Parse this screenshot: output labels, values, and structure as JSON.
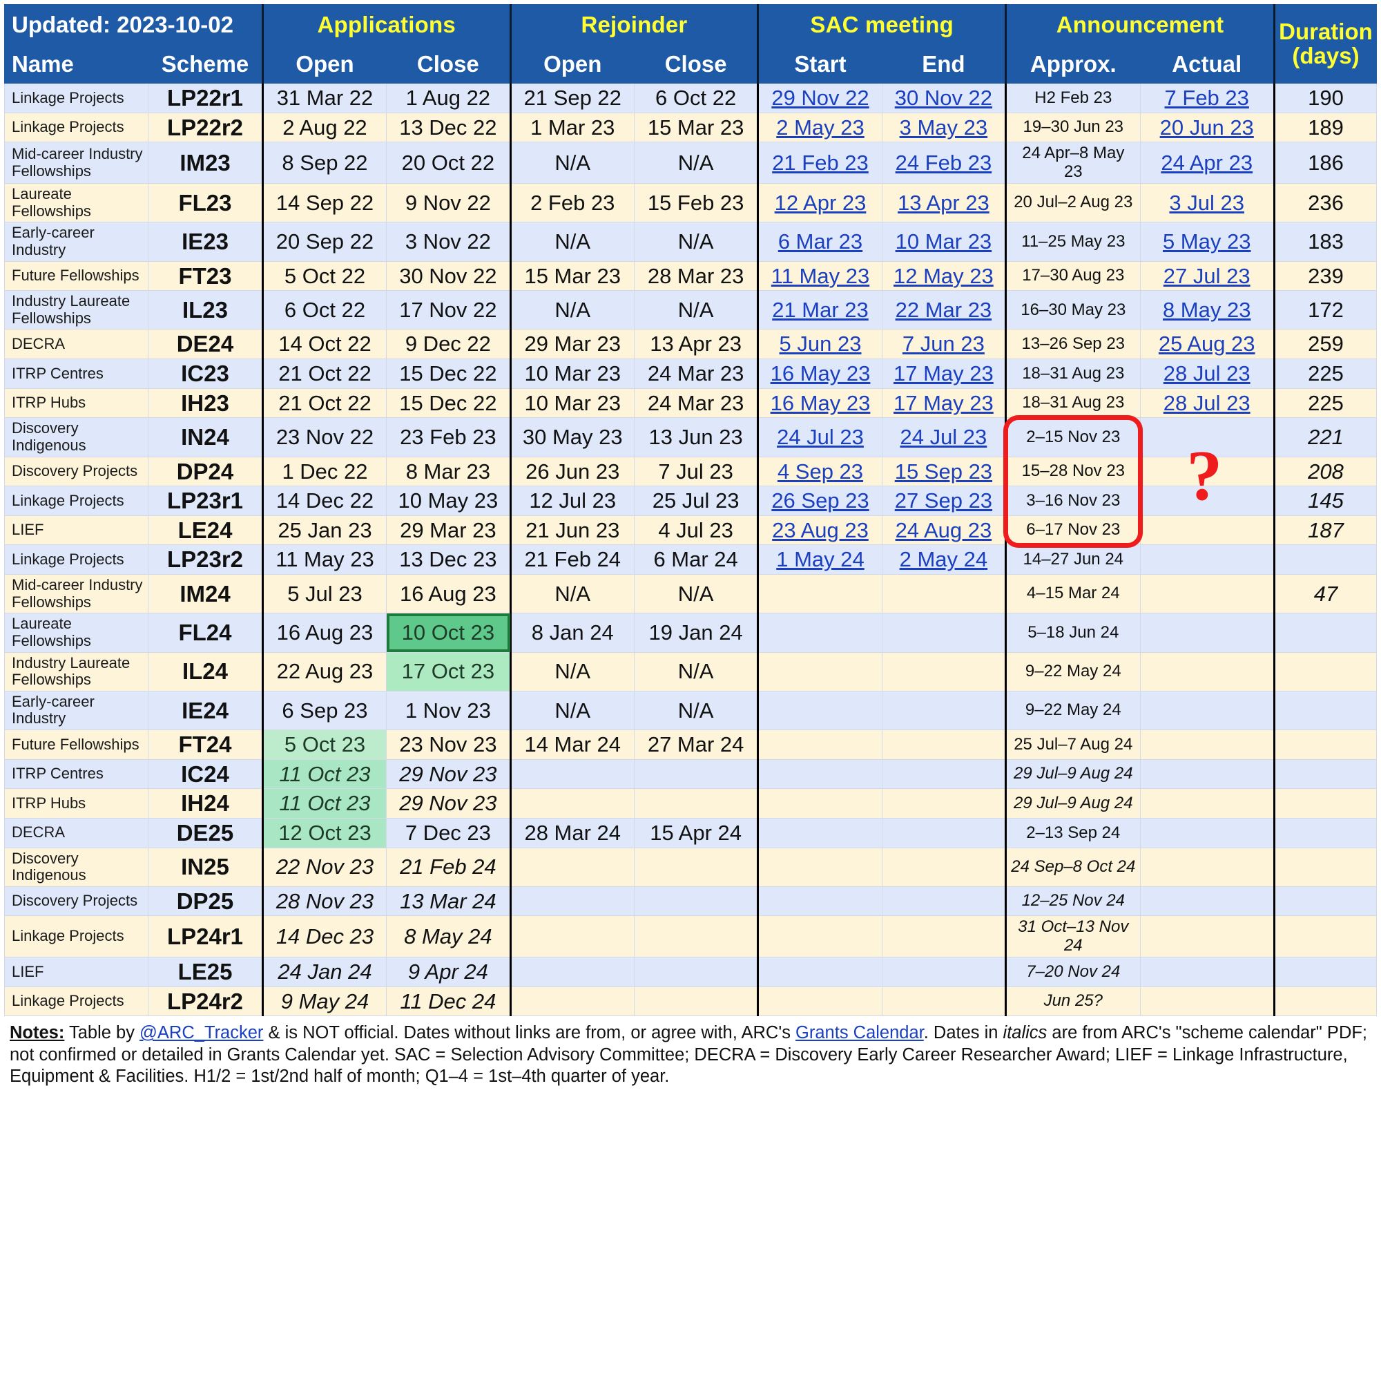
{
  "header": {
    "updated": "Updated: 2023-10-02",
    "col_name": "Name",
    "col_scheme": "Scheme",
    "group_applications": "Applications",
    "group_rejoinder": "Rejoinder",
    "group_sac": "SAC meeting",
    "group_announcement": "Announcement",
    "applications_open": "Open",
    "applications_close": "Close",
    "rejoinder_open": "Open",
    "rejoinder_close": "Close",
    "sac_start": "Start",
    "sac_end": "End",
    "ann_approx": "Approx.",
    "ann_actual": "Actual",
    "duration_l1": "Duration",
    "duration_l2": "(days)"
  },
  "colors": {
    "header_bg": "#1f5aa6",
    "header_group_text": "#ffff33",
    "row_odd": "#dfe8fb",
    "row_even": "#fdf4d9",
    "link": "#1a3fbf",
    "highlight_red": "#ee1c1c",
    "highlight_green": "#5ec98b"
  },
  "annotation": {
    "question_mark": "?"
  },
  "table": {
    "columns": [
      "Name",
      "Scheme",
      "Applications Open",
      "Applications Close",
      "Rejoinder Open",
      "Rejoinder Close",
      "SAC Start",
      "SAC End",
      "Announcement Approx.",
      "Announcement Actual",
      "Duration (days)"
    ],
    "rows": [
      {
        "name": "Linkage Projects",
        "scheme": "LP22r1",
        "app_open": "31 Mar 22",
        "app_close": "1 Aug 22",
        "rej_open": "21 Sep 22",
        "rej_close": "6 Oct 22",
        "sac_start": "29 Nov 22",
        "sac_end": "30 Nov 22",
        "ann_approx": "H2 Feb 23",
        "ann_actual": "7 Feb 23",
        "duration": "190"
      },
      {
        "name": "Linkage Projects",
        "scheme": "LP22r2",
        "app_open": "2 Aug 22",
        "app_close": "13 Dec 22",
        "rej_open": "1 Mar 23",
        "rej_close": "15 Mar 23",
        "sac_start": "2 May 23",
        "sac_end": "3 May 23",
        "ann_approx": "19–30 Jun 23",
        "ann_actual": "20 Jun 23",
        "duration": "189"
      },
      {
        "name": "Mid-career Industry Fellowships",
        "scheme": "IM23",
        "app_open": "8 Sep 22",
        "app_close": "20 Oct 22",
        "rej_open": "N/A",
        "rej_close": "N/A",
        "sac_start": "21 Feb 23",
        "sac_end": "24 Feb 23",
        "ann_approx": "24 Apr–8 May 23",
        "ann_actual": "24 Apr 23",
        "duration": "186"
      },
      {
        "name": "Laureate Fellowships",
        "scheme": "FL23",
        "app_open": "14 Sep 22",
        "app_close": "9 Nov 22",
        "rej_open": "2 Feb 23",
        "rej_close": "15 Feb 23",
        "sac_start": "12 Apr 23",
        "sac_end": "13 Apr 23",
        "ann_approx": "20 Jul–2 Aug 23",
        "ann_actual": "3 Jul 23",
        "duration": "236"
      },
      {
        "name": "Early-career Industry",
        "scheme": "IE23",
        "app_open": "20 Sep 22",
        "app_close": "3 Nov 22",
        "rej_open": "N/A",
        "rej_close": "N/A",
        "sac_start": "6 Mar 23",
        "sac_end": "10 Mar 23",
        "ann_approx": "11–25 May 23",
        "ann_actual": "5 May 23",
        "duration": "183"
      },
      {
        "name": "Future Fellowships",
        "scheme": "FT23",
        "app_open": "5 Oct 22",
        "app_close": "30 Nov 22",
        "rej_open": "15 Mar 23",
        "rej_close": "28 Mar 23",
        "sac_start": "11 May 23",
        "sac_end": "12 May 23",
        "ann_approx": "17–30 Aug 23",
        "ann_actual": "27 Jul 23",
        "duration": "239"
      },
      {
        "name": "Industry Laureate Fellowships",
        "scheme": "IL23",
        "app_open": "6 Oct 22",
        "app_close": "17 Nov 22",
        "rej_open": "N/A",
        "rej_close": "N/A",
        "sac_start": "21 Mar 23",
        "sac_end": "22 Mar 23",
        "ann_approx": "16–30 May 23",
        "ann_actual": "8 May 23",
        "duration": "172"
      },
      {
        "name": "DECRA",
        "scheme": "DE24",
        "app_open": "14 Oct 22",
        "app_close": "9 Dec 22",
        "rej_open": "29 Mar 23",
        "rej_close": "13 Apr 23",
        "sac_start": "5 Jun 23",
        "sac_end": "7 Jun 23",
        "ann_approx": "13–26 Sep 23",
        "ann_actual": "25 Aug 23",
        "duration": "259"
      },
      {
        "name": "ITRP Centres",
        "scheme": "IC23",
        "app_open": "21 Oct 22",
        "app_close": "15 Dec 22",
        "rej_open": "10 Mar 23",
        "rej_close": "24 Mar 23",
        "sac_start": "16 May 23",
        "sac_end": "17 May 23",
        "ann_approx": "18–31 Aug 23",
        "ann_actual": "28 Jul 23",
        "duration": "225"
      },
      {
        "name": "ITRP Hubs",
        "scheme": "IH23",
        "app_open": "21 Oct 22",
        "app_close": "15 Dec 22",
        "rej_open": "10 Mar 23",
        "rej_close": "24 Mar 23",
        "sac_start": "16 May 23",
        "sac_end": "17 May 23",
        "ann_approx": "18–31 Aug 23",
        "ann_actual": "28 Jul 23",
        "duration": "225"
      },
      {
        "name": "Discovery Indigenous",
        "scheme": "IN24",
        "app_open": "23 Nov 22",
        "app_close": "23 Feb 23",
        "rej_open": "30 May 23",
        "rej_close": "13 Jun 23",
        "sac_start": "24 Jul 23",
        "sac_end": "24 Jul 23",
        "ann_approx": "2–15 Nov 23",
        "ann_actual": "",
        "duration": "221"
      },
      {
        "name": "Discovery Projects",
        "scheme": "DP24",
        "app_open": "1 Dec 22",
        "app_close": "8 Mar 23",
        "rej_open": "26 Jun 23",
        "rej_close": "7 Jul 23",
        "sac_start": "4 Sep 23",
        "sac_end": "15 Sep 23",
        "ann_approx": "15–28 Nov 23",
        "ann_actual": "",
        "duration": "208"
      },
      {
        "name": "Linkage Projects",
        "scheme": "LP23r1",
        "app_open": "14 Dec 22",
        "app_close": "10 May 23",
        "rej_open": "12 Jul 23",
        "rej_close": "25 Jul 23",
        "sac_start": "26 Sep 23",
        "sac_end": "27 Sep 23",
        "ann_approx": "3–16 Nov 23",
        "ann_actual": "",
        "duration": "145"
      },
      {
        "name": "LIEF",
        "scheme": "LE24",
        "app_open": "25 Jan 23",
        "app_close": "29 Mar 23",
        "rej_open": "21 Jun 23",
        "rej_close": "4 Jul 23",
        "sac_start": "23 Aug 23",
        "sac_end": "24 Aug 23",
        "ann_approx": "6–17 Nov 23",
        "ann_actual": "",
        "duration": "187"
      },
      {
        "name": "Linkage Projects",
        "scheme": "LP23r2",
        "app_open": "11 May 23",
        "app_close": "13 Dec 23",
        "rej_open": "21 Feb 24",
        "rej_close": "6 Mar 24",
        "sac_start": "1 May 24",
        "sac_end": "2 May 24",
        "ann_approx": "14–27 Jun 24",
        "ann_actual": "",
        "duration": ""
      },
      {
        "name": "Mid-career Industry Fellowships",
        "scheme": "IM24",
        "app_open": "5 Jul 23",
        "app_close": "16 Aug 23",
        "rej_open": "N/A",
        "rej_close": "N/A",
        "sac_start": "",
        "sac_end": "",
        "ann_approx": "4–15 Mar 24",
        "ann_actual": "",
        "duration": "47"
      },
      {
        "name": "Laureate Fellowships",
        "scheme": "FL24",
        "app_open": "16 Aug 23",
        "app_close": "10 Oct 23",
        "rej_open": "8 Jan 24",
        "rej_close": "19 Jan 24",
        "sac_start": "",
        "sac_end": "",
        "ann_approx": "5–18 Jun 24",
        "ann_actual": "",
        "duration": ""
      },
      {
        "name": "Industry Laureate Fellowships",
        "scheme": "IL24",
        "app_open": "22 Aug 23",
        "app_close": "17 Oct 23",
        "rej_open": "N/A",
        "rej_close": "N/A",
        "sac_start": "",
        "sac_end": "",
        "ann_approx": "9–22 May 24",
        "ann_actual": "",
        "duration": ""
      },
      {
        "name": "Early-career Industry",
        "scheme": "IE24",
        "app_open": "6 Sep 23",
        "app_close": "1 Nov 23",
        "rej_open": "N/A",
        "rej_close": "N/A",
        "sac_start": "",
        "sac_end": "",
        "ann_approx": "9–22 May 24",
        "ann_actual": "",
        "duration": ""
      },
      {
        "name": "Future Fellowships",
        "scheme": "FT24",
        "app_open": "5 Oct 23",
        "app_close": "23 Nov 23",
        "rej_open": "14 Mar 24",
        "rej_close": "27 Mar 24",
        "sac_start": "",
        "sac_end": "",
        "ann_approx": "25 Jul–7 Aug 24",
        "ann_actual": "",
        "duration": ""
      },
      {
        "name": "ITRP Centres",
        "scheme": "IC24",
        "app_open": "11 Oct 23",
        "app_close": "29 Nov 23",
        "rej_open": "",
        "rej_close": "",
        "sac_start": "",
        "sac_end": "",
        "ann_approx": "29 Jul–9 Aug 24",
        "ann_actual": "",
        "duration": ""
      },
      {
        "name": "ITRP Hubs",
        "scheme": "IH24",
        "app_open": "11 Oct 23",
        "app_close": "29 Nov 23",
        "rej_open": "",
        "rej_close": "",
        "sac_start": "",
        "sac_end": "",
        "ann_approx": "29 Jul–9 Aug 24",
        "ann_actual": "",
        "duration": ""
      },
      {
        "name": "DECRA",
        "scheme": "DE25",
        "app_open": "12 Oct 23",
        "app_close": "7 Dec 23",
        "rej_open": "28 Mar 24",
        "rej_close": "15 Apr 24",
        "sac_start": "",
        "sac_end": "",
        "ann_approx": "2–13 Sep 24",
        "ann_actual": "",
        "duration": ""
      },
      {
        "name": "Discovery Indigenous",
        "scheme": "IN25",
        "app_open": "22 Nov 23",
        "app_close": "21 Feb 24",
        "rej_open": "",
        "rej_close": "",
        "sac_start": "",
        "sac_end": "",
        "ann_approx": "24 Sep–8 Oct 24",
        "ann_actual": "",
        "duration": ""
      },
      {
        "name": "Discovery Projects",
        "scheme": "DP25",
        "app_open": "28 Nov 23",
        "app_close": "13 Mar 24",
        "rej_open": "",
        "rej_close": "",
        "sac_start": "",
        "sac_end": "",
        "ann_approx": "12–25 Nov 24",
        "ann_actual": "",
        "duration": ""
      },
      {
        "name": "Linkage Projects",
        "scheme": "LP24r1",
        "app_open": "14 Dec 23",
        "app_close": "8 May 24",
        "rej_open": "",
        "rej_close": "",
        "sac_start": "",
        "sac_end": "",
        "ann_approx": "31 Oct–13 Nov 24",
        "ann_actual": "",
        "duration": ""
      },
      {
        "name": "LIEF",
        "scheme": "LE25",
        "app_open": "24 Jan 24",
        "app_close": "9 Apr 24",
        "rej_open": "",
        "rej_close": "",
        "sac_start": "",
        "sac_end": "",
        "ann_approx": "7–20 Nov 24",
        "ann_actual": "",
        "duration": ""
      },
      {
        "name": "Linkage Projects",
        "scheme": "LP24r2",
        "app_open": "9 May 24",
        "app_close": "11 Dec 24",
        "rej_open": "",
        "rej_close": "",
        "sac_start": "",
        "sac_end": "",
        "ann_approx": "Jun 25?",
        "ann_actual": "",
        "duration": ""
      }
    ],
    "row_styles": [
      {
        "links": [
          "sac_start",
          "sac_end",
          "ann_actual"
        ]
      },
      {
        "links": [
          "sac_start",
          "sac_end",
          "ann_actual"
        ]
      },
      {
        "links": [
          "sac_start",
          "sac_end",
          "ann_actual"
        ]
      },
      {
        "links": [
          "sac_start",
          "sac_end",
          "ann_actual"
        ]
      },
      {
        "links": [
          "sac_start",
          "sac_end",
          "ann_actual"
        ]
      },
      {
        "links": [
          "sac_start",
          "sac_end",
          "ann_actual"
        ]
      },
      {
        "links": [
          "sac_start",
          "sac_end",
          "ann_actual"
        ]
      },
      {
        "links": [
          "sac_start",
          "sac_end",
          "ann_actual"
        ]
      },
      {
        "links": [
          "sac_start",
          "sac_end",
          "ann_actual"
        ]
      },
      {
        "links": [
          "sac_start",
          "sac_end",
          "ann_actual"
        ]
      },
      {
        "links": [
          "sac_start",
          "sac_end"
        ],
        "italic": [
          "duration"
        ]
      },
      {
        "links": [
          "sac_start",
          "sac_end"
        ],
        "italic": [
          "duration"
        ]
      },
      {
        "links": [
          "sac_start",
          "sac_end"
        ],
        "italic": [
          "duration"
        ]
      },
      {
        "links": [
          "sac_start",
          "sac_end"
        ],
        "italic": [
          "duration"
        ]
      },
      {
        "links": [
          "sac_start",
          "sac_end"
        ]
      },
      {
        "italic": [
          "duration"
        ]
      },
      {
        "hl_strong": [
          "app_close"
        ]
      },
      {
        "hl_mid": [
          "app_close"
        ]
      },
      {},
      {
        "hl_light": [
          "app_open"
        ]
      },
      {
        "hl_soft": [
          "app_open"
        ],
        "italic": [
          "app_open",
          "app_close",
          "ann_approx"
        ]
      },
      {
        "hl_soft": [
          "app_open"
        ],
        "italic": [
          "app_open",
          "app_close",
          "ann_approx"
        ]
      },
      {
        "hl_soft": [
          "app_open"
        ]
      },
      {
        "italic": [
          "app_open",
          "app_close",
          "ann_approx"
        ]
      },
      {
        "italic": [
          "app_open",
          "app_close",
          "ann_approx"
        ]
      },
      {
        "italic": [
          "app_open",
          "app_close",
          "ann_approx"
        ]
      },
      {
        "italic": [
          "app_open",
          "app_close",
          "ann_approx"
        ]
      },
      {
        "italic": [
          "app_open",
          "app_close",
          "ann_approx"
        ]
      }
    ]
  },
  "notes": {
    "label": "Notes:",
    "seg1": " Table by ",
    "link1": "@ARC_Tracker",
    "seg2": " & is NOT official. Dates without links are from, or agree with, ARC's ",
    "link2": "Grants Calendar",
    "seg3": ". Dates in ",
    "italic_word": "italics",
    "seg4": " are from ARC's \"scheme calendar\" PDF; not confirmed or detailed in Grants Calendar yet. SAC = Selection Advisory Committee; DECRA = Discovery Early Career Researcher Award; LIEF = Linkage Infrastructure, Equipment & Facilities. H1/2 = 1st/2nd half of month; Q1–4 = 1st–4th quarter of year."
  }
}
